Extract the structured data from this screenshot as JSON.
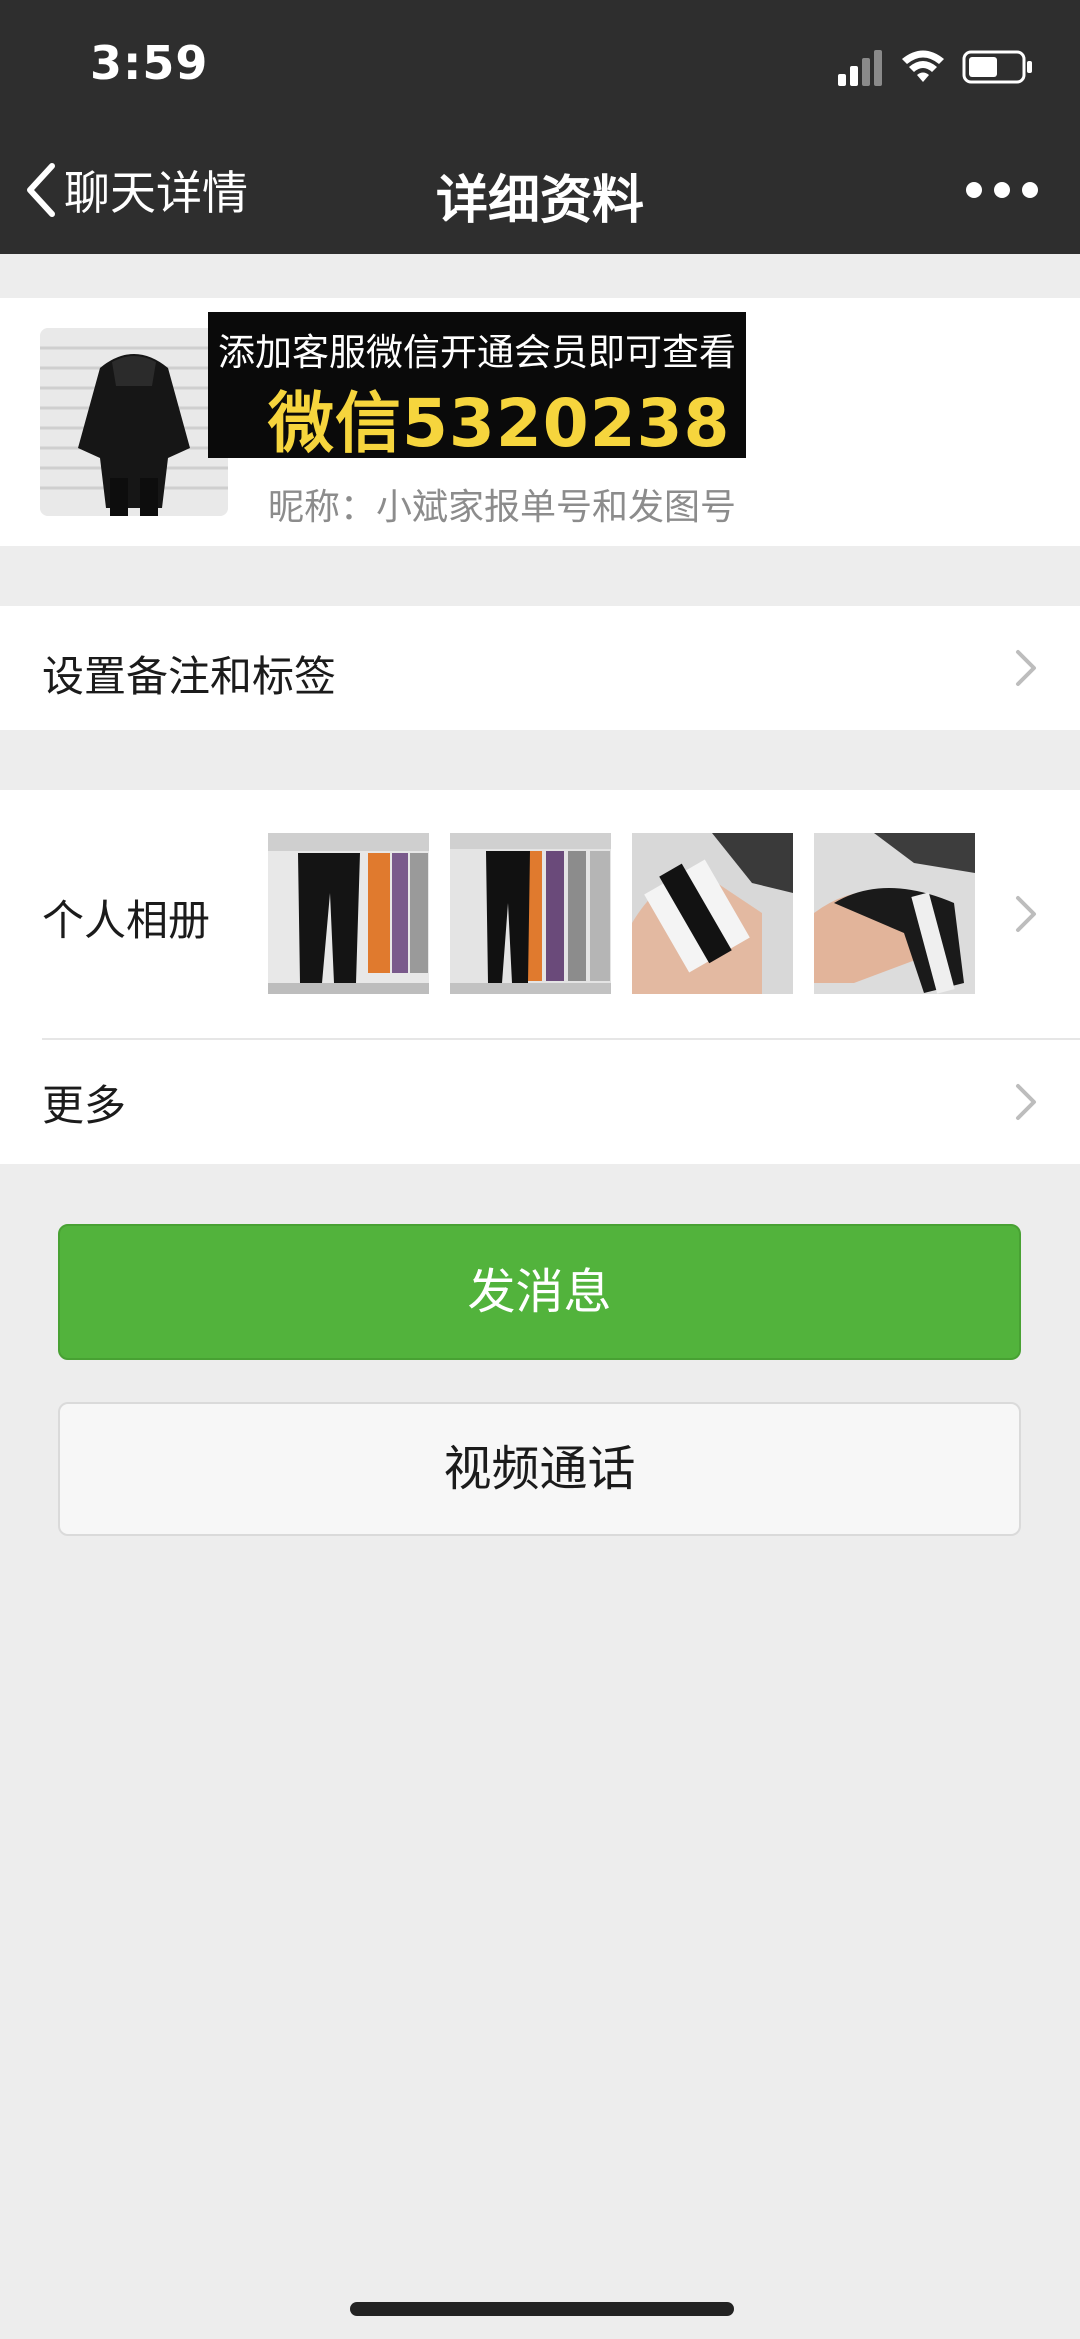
{
  "status_bar": {
    "time": "3:59"
  },
  "nav": {
    "back_label": "聊天详情",
    "title": "详细资料"
  },
  "profile": {
    "ad_line1": "添加客服微信开通会员即可查看",
    "ad_line2": "微信5320238",
    "nickname": "昵称：小斌家报单号和发图号"
  },
  "settings": {
    "remark_label": "设置备注和标签"
  },
  "album": {
    "label": "个人相册"
  },
  "more": {
    "label": "更多"
  },
  "actions": {
    "send_message": "发消息",
    "video_call": "视频通话"
  },
  "colors": {
    "header_bg": "#2e2e2e",
    "page_bg": "#ededed",
    "primary_green": "#52b33c",
    "ad_yellow": "#f6d53d"
  }
}
